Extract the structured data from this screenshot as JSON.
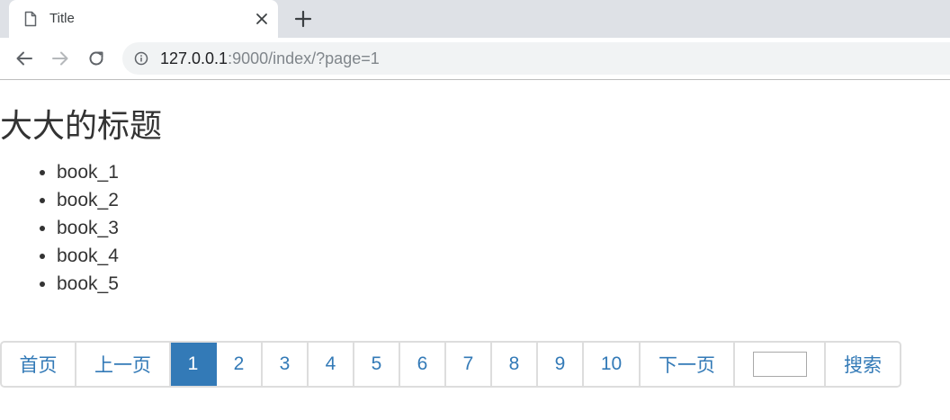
{
  "browser": {
    "tab": {
      "title": "Title",
      "icon": "document-icon",
      "close_icon": "close-icon"
    },
    "new_tab_icon": "plus-icon",
    "nav": {
      "back_icon": "arrow-left-icon",
      "forward_icon": "arrow-right-icon",
      "reload_icon": "reload-icon"
    },
    "address_bar": {
      "security_icon": "info-icon",
      "url_host": "127.0.0.1",
      "url_rest": ":9000/index/?page=1"
    }
  },
  "page": {
    "heading": "大大的标题",
    "books": [
      "book_1",
      "book_2",
      "book_3",
      "book_4",
      "book_5"
    ]
  },
  "pagination": {
    "first_label": "首页",
    "prev_label": "上一页",
    "pages": [
      "1",
      "2",
      "3",
      "4",
      "5",
      "6",
      "7",
      "8",
      "9",
      "10"
    ],
    "active_page": "1",
    "next_label": "下一页",
    "jump_input_value": "",
    "search_label": "搜索"
  },
  "colors": {
    "link": "#337ab7",
    "active_bg": "#337ab7",
    "border": "#dddddd",
    "text": "#333333"
  }
}
